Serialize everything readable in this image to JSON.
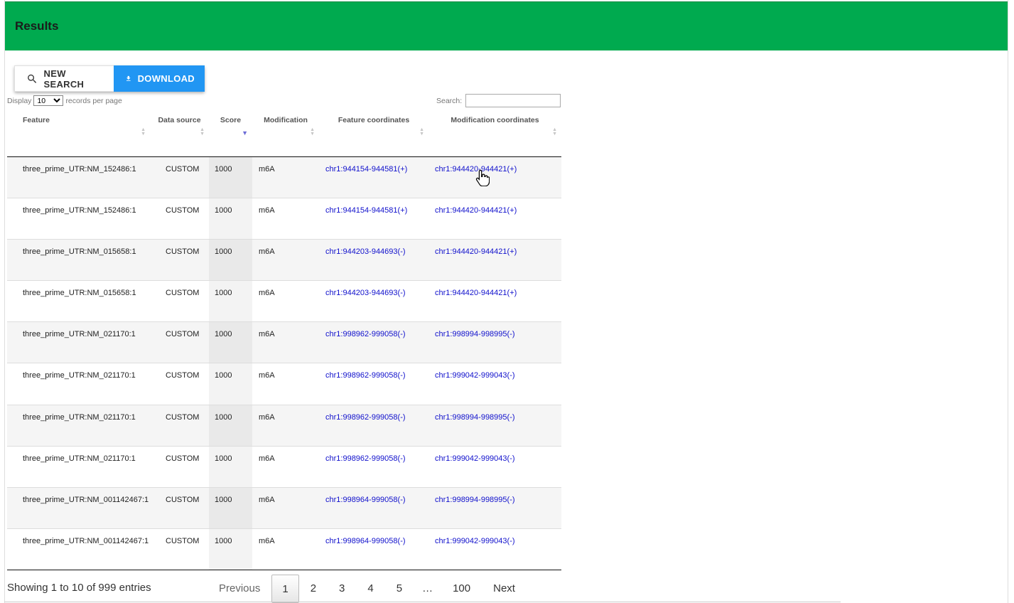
{
  "header": {
    "title": "Results"
  },
  "toolbar": {
    "new_search_label": "NEW SEARCH",
    "download_label": "DOWNLOAD"
  },
  "length_control": {
    "prefix": "Display",
    "selected": "10",
    "suffix": "records per page"
  },
  "search": {
    "label": "Search:",
    "value": ""
  },
  "table": {
    "columns": [
      "Feature",
      "Data source",
      "Score",
      "Modification",
      "Feature coordinates",
      "Modification coordinates"
    ],
    "rows": [
      [
        "three_prime_UTR:NM_152486:1",
        "CUSTOM",
        "1000",
        "m6A",
        "chr1:944154-944581(+)",
        "chr1:944420-944421(+)"
      ],
      [
        "three_prime_UTR:NM_152486:1",
        "CUSTOM",
        "1000",
        "m6A",
        "chr1:944154-944581(+)",
        "chr1:944420-944421(+)"
      ],
      [
        "three_prime_UTR:NM_015658:1",
        "CUSTOM",
        "1000",
        "m6A",
        "chr1:944203-944693(-)",
        "chr1:944420-944421(+)"
      ],
      [
        "three_prime_UTR:NM_015658:1",
        "CUSTOM",
        "1000",
        "m6A",
        "chr1:944203-944693(-)",
        "chr1:944420-944421(+)"
      ],
      [
        "three_prime_UTR:NM_021170:1",
        "CUSTOM",
        "1000",
        "m6A",
        "chr1:998962-999058(-)",
        "chr1:998994-998995(-)"
      ],
      [
        "three_prime_UTR:NM_021170:1",
        "CUSTOM",
        "1000",
        "m6A",
        "chr1:998962-999058(-)",
        "chr1:999042-999043(-)"
      ],
      [
        "three_prime_UTR:NM_021170:1",
        "CUSTOM",
        "1000",
        "m6A",
        "chr1:998962-999058(-)",
        "chr1:998994-998995(-)"
      ],
      [
        "three_prime_UTR:NM_021170:1",
        "CUSTOM",
        "1000",
        "m6A",
        "chr1:998962-999058(-)",
        "chr1:999042-999043(-)"
      ],
      [
        "three_prime_UTR:NM_001142467:1",
        "CUSTOM",
        "1000",
        "m6A",
        "chr1:998964-999058(-)",
        "chr1:998994-998995(-)"
      ],
      [
        "three_prime_UTR:NM_001142467:1",
        "CUSTOM",
        "1000",
        "m6A",
        "chr1:998964-999058(-)",
        "chr1:999042-999043(-)"
      ]
    ]
  },
  "info": "Showing 1 to 10 of 999 entries",
  "pagination": {
    "previous": "Previous",
    "pages": [
      "1",
      "2",
      "3",
      "4",
      "5"
    ],
    "ellipsis": "…",
    "last": "100",
    "next": "Next",
    "current": "1"
  },
  "colors": {
    "header": "#00aa4f",
    "download": "#2196f3",
    "link": "#1010cc"
  },
  "icons": {
    "new_search": "search-icon",
    "download": "download-icon",
    "cursor": "hand-pointer-icon"
  }
}
